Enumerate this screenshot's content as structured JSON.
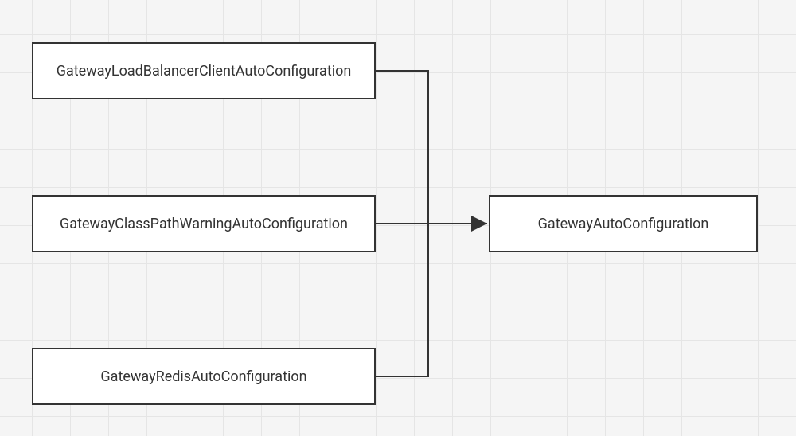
{
  "diagram": {
    "nodes": {
      "load_balancer": "GatewayLoadBalancerClientAutoConfiguration",
      "classpath_warning": "GatewayClassPathWarningAutoConfiguration",
      "redis": "GatewayRedisAutoConfiguration",
      "auto_config": "GatewayAutoConfiguration"
    },
    "edges": [
      {
        "from": "load_balancer",
        "to": "auto_config"
      },
      {
        "from": "classpath_warning",
        "to": "auto_config"
      },
      {
        "from": "redis",
        "to": "auto_config"
      }
    ]
  }
}
